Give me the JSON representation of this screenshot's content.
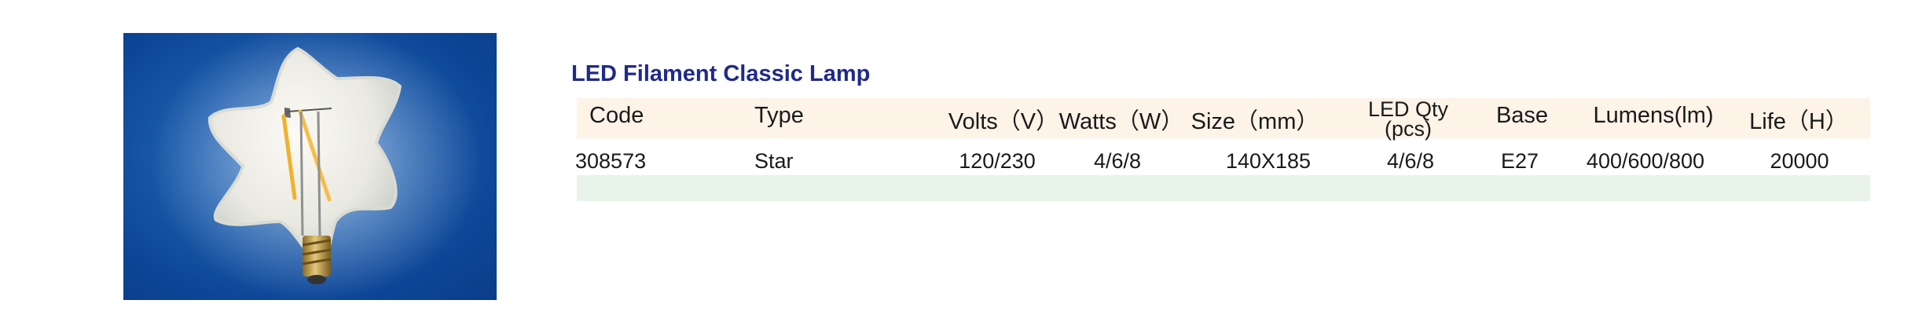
{
  "product": {
    "title": "LED Filament Classic Lamp",
    "image_alt": "star-shaped LED filament bulb with E27 base on blue background"
  },
  "table": {
    "headers": {
      "code": "Code",
      "type": "Type",
      "volts": "Volts（V）",
      "watts": "Watts（W）",
      "size": "Size（mm）",
      "led_qty_line1": "LED Qty",
      "led_qty_line2": "(pcs)",
      "base": "Base",
      "lumens": "Lumens(lm)",
      "life": "Life（H）"
    },
    "rows": [
      {
        "code": "308573",
        "type": "Star",
        "volts": "120/230",
        "watts": "4/6/8",
        "size": "140X185",
        "led_qty": "4/6/8",
        "base": "E27",
        "lumens": "400/600/800",
        "life": "20000"
      }
    ]
  },
  "colors": {
    "title": "#1f2a8a",
    "header_band": "#fdf3e7",
    "data_band": "#e8f3ea",
    "photo_background": "#0d4596"
  }
}
